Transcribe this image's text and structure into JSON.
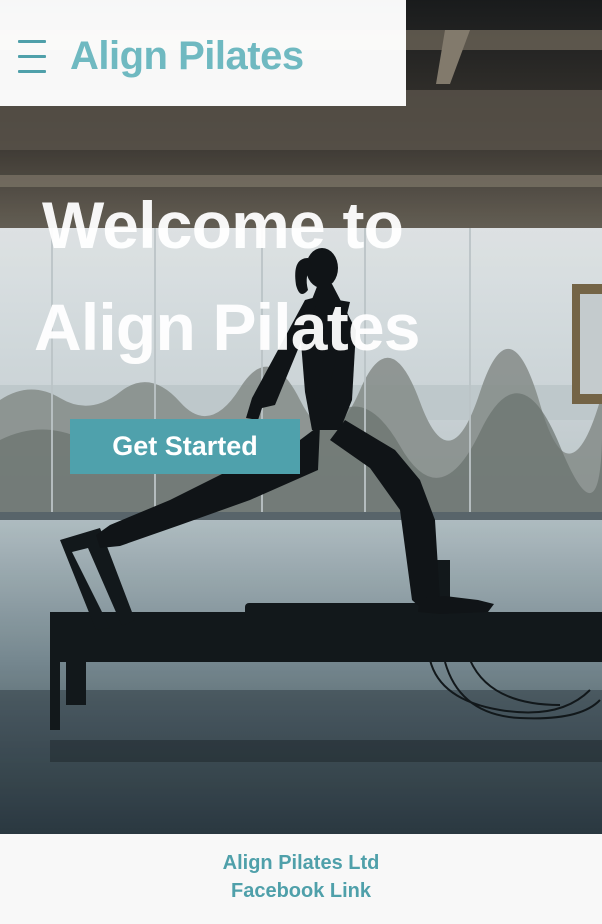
{
  "header": {
    "menu_icon": "hamburger-menu-icon",
    "brand": "Align Pilates"
  },
  "hero": {
    "title_line1": "Welcome to",
    "title_line2": "Align Pilates",
    "cta_label": "Get Started",
    "image_subject": "silhouette of woman on pilates reformer by large window"
  },
  "footer": {
    "company": "Align Pilates Ltd",
    "link": "Facebook Link"
  },
  "colors": {
    "accent": "#4fa1ac",
    "brand_text": "#6fb9c1",
    "header_bg": "#ffffff",
    "footer_bg": "#f8f8f8"
  }
}
